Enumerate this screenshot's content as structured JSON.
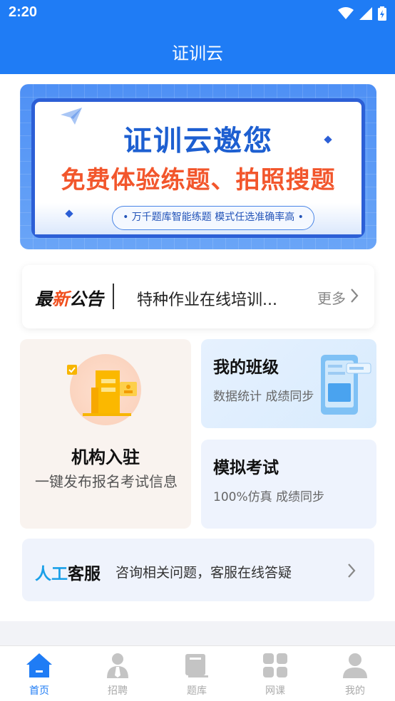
{
  "status_bar": {
    "time": "2:20"
  },
  "header": {
    "title": "证训云"
  },
  "banner": {
    "title": "证训云邀您",
    "subtitle": "免费体验练题、拍照搜题",
    "tagline": "• 万千题库智能练题  模式任选准确率高 •"
  },
  "notice": {
    "label_prefix": "最",
    "label_highlight": "新",
    "label_suffix": "公告",
    "text": "特种作业在线培训...",
    "more": "更多"
  },
  "features": {
    "org": {
      "title": "机构入驻",
      "desc": "一键发布报名考试信息"
    },
    "class": {
      "title": "我的班级",
      "desc": "数据统计 成绩同步"
    },
    "exam": {
      "title": "模拟考试",
      "desc": "100%仿真 成绩同步"
    }
  },
  "service": {
    "label_highlight": "人工",
    "label_rest": "客服",
    "text": "咨询相关问题，客服在线答疑"
  },
  "tabs": [
    {
      "label": "首页",
      "icon": "home-icon",
      "active": true
    },
    {
      "label": "招聘",
      "icon": "recruit-icon",
      "active": false
    },
    {
      "label": "题库",
      "icon": "book-icon",
      "active": false
    },
    {
      "label": "网课",
      "icon": "grid-icon",
      "active": false
    },
    {
      "label": "我的",
      "icon": "user-icon",
      "active": false
    }
  ],
  "colors": {
    "primary": "#1f7cf5",
    "accent": "#f04f1e",
    "inactive": "#aaaaaa"
  }
}
